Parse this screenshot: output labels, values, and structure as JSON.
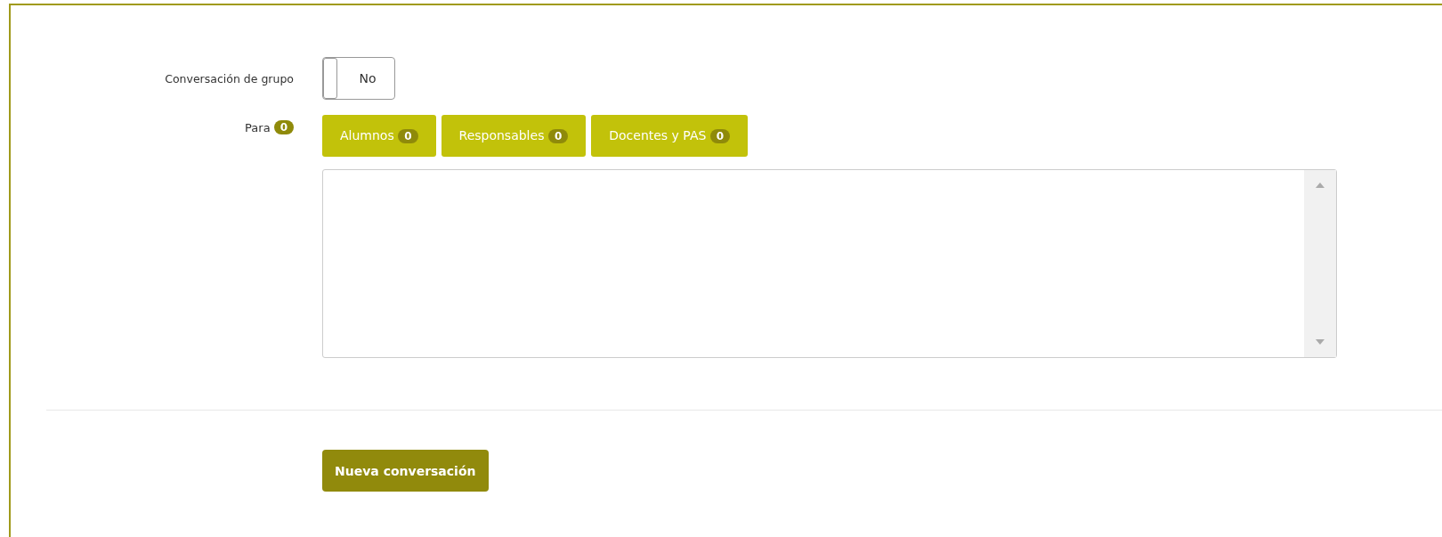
{
  "group_toggle": {
    "label": "Conversación de grupo",
    "on": false,
    "value_text": "No"
  },
  "recipients": {
    "label": "Para",
    "count": "0",
    "tabs": [
      {
        "label": "Alumnos",
        "count": "0"
      },
      {
        "label": "Responsables",
        "count": "0"
      },
      {
        "label": "Docentes y PAS",
        "count": "0"
      }
    ]
  },
  "submit_button": "Nueva conversación"
}
